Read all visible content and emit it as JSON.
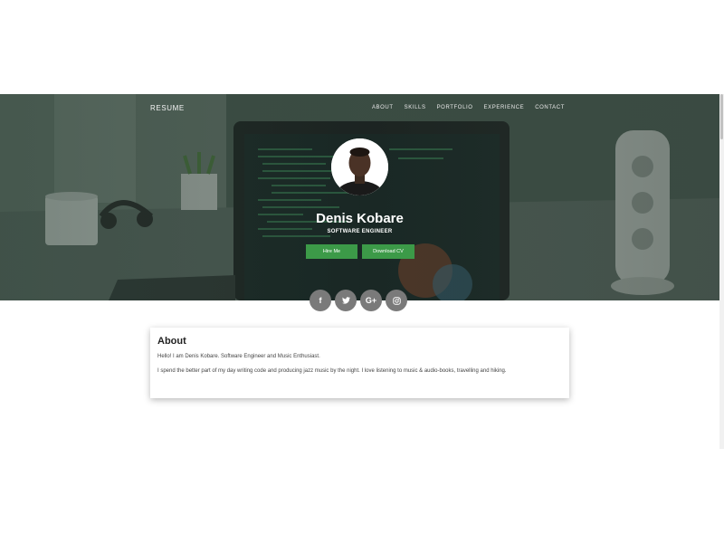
{
  "nav": {
    "brand": "RESUME",
    "links": [
      "ABOUT",
      "SKILLS",
      "PORTFOLIO",
      "EXPERIENCE",
      "CONTACT"
    ]
  },
  "profile": {
    "name": "Denis Kobare",
    "title": "SOFTWARE ENGINEER"
  },
  "buttons": {
    "hire": "Hire Me",
    "cv": "Download CV"
  },
  "social": [
    {
      "icon": "facebook-icon",
      "glyph": "f"
    },
    {
      "icon": "twitter-icon",
      "glyph": "t"
    },
    {
      "icon": "google-plus-icon",
      "glyph": "G+"
    },
    {
      "icon": "instagram-icon",
      "glyph": "ig"
    }
  ],
  "about": {
    "heading": "About",
    "line1": "Hello! I am Denis Kobare. Software Engineer and Music Enthusiast.",
    "line2": "I spend the better part of my day writing code and producing jazz music by the night. I love listening to music & audio-books, travelling and hiking."
  },
  "colors": {
    "accent": "#3c9a48",
    "social_bg": "#7a7a7a",
    "hero_tint": "#33463c"
  }
}
